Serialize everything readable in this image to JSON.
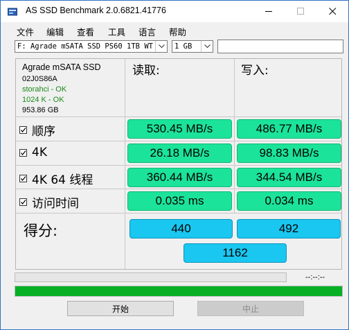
{
  "window": {
    "title": "AS SSD Benchmark 2.0.6821.41776"
  },
  "menu": [
    "文件",
    "编辑",
    "查看",
    "工具",
    "语言",
    "帮助"
  ],
  "toolbar": {
    "drive_select": "F: Agrade mSATA SSD PS60 1TB WT",
    "size_select": "1 GB",
    "text_field_value": ""
  },
  "info": {
    "model": "Agrade mSATA SSD",
    "firmware": "02J0S86A",
    "driver_status": "storahci - OK",
    "alignment_status": "1024 K - OK",
    "capacity": "953.86 GB"
  },
  "columns": {
    "read": "读取:",
    "write": "写入:"
  },
  "tests": [
    {
      "label": "顺序",
      "checked": true,
      "read": "530.45 MB/s",
      "write": "486.77 MB/s"
    },
    {
      "label": "4K",
      "checked": true,
      "read": "26.18 MB/s",
      "write": "98.83 MB/s"
    },
    {
      "label": "4K 64 线程",
      "checked": true,
      "read": "360.44 MB/s",
      "write": "344.54 MB/s"
    },
    {
      "label": "访问时间",
      "checked": true,
      "read": "0.035 ms",
      "write": "0.034 ms"
    }
  ],
  "score": {
    "label": "得分:",
    "read": "440",
    "write": "492",
    "total": "1162"
  },
  "progress": {
    "time": "--:--:--",
    "test_fraction": 0,
    "overall_fraction": 1.0
  },
  "buttons": {
    "start": "开始",
    "stop": "中止"
  },
  "colors": {
    "result_green": "#1ce39a",
    "score_blue": "#1ac7f0",
    "progress_green": "#06b025",
    "window_border": "#2f6fc6"
  }
}
